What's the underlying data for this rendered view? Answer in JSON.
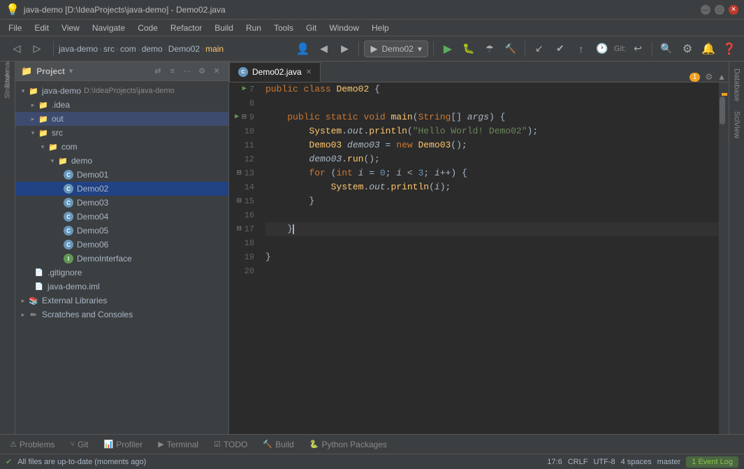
{
  "titleBar": {
    "title": "java-demo [D:\\IdeaProjects\\java-demo] - Demo02.java",
    "minimize": "—",
    "maximize": "□",
    "close": "✕"
  },
  "menuBar": {
    "items": [
      "File",
      "Edit",
      "View",
      "Navigate",
      "Code",
      "Refactor",
      "Build",
      "Run",
      "Tools",
      "Git",
      "Window",
      "Help"
    ]
  },
  "toolbar": {
    "runConfig": "Demo02",
    "gitLabel": "Git:"
  },
  "breadcrumb": {
    "items": [
      "java-demo",
      "src",
      "com",
      "demo",
      "Demo02",
      "main"
    ]
  },
  "projectPanel": {
    "title": "Project",
    "root": {
      "label": "java-demo",
      "path": "D:\\IdeaProjects\\java-demo",
      "children": [
        {
          "label": ".idea",
          "type": "folder",
          "expanded": false
        },
        {
          "label": "out",
          "type": "folder-out",
          "expanded": false,
          "selected": false,
          "highlighted": true
        },
        {
          "label": "src",
          "type": "folder",
          "expanded": true,
          "children": [
            {
              "label": "com",
              "type": "folder",
              "expanded": true,
              "children": [
                {
                  "label": "demo",
                  "type": "folder",
                  "expanded": true,
                  "children": [
                    {
                      "label": "Demo01",
                      "type": "java"
                    },
                    {
                      "label": "Demo02",
                      "type": "java",
                      "selected": true
                    },
                    {
                      "label": "Demo03",
                      "type": "java"
                    },
                    {
                      "label": "Demo04",
                      "type": "java"
                    },
                    {
                      "label": "Demo05",
                      "type": "java"
                    },
                    {
                      "label": "Demo06",
                      "type": "java"
                    },
                    {
                      "label": "DemoInterface",
                      "type": "java-interface"
                    }
                  ]
                }
              ]
            }
          ]
        },
        {
          "label": ".gitignore",
          "type": "file"
        },
        {
          "label": "java-demo.iml",
          "type": "file"
        }
      ]
    },
    "externalLibraries": "External Libraries",
    "scratches": "Scratches and Consoles"
  },
  "editorTab": {
    "filename": "Demo02.java",
    "warningCount": "1"
  },
  "codeLines": [
    {
      "num": 7,
      "content": "public class Demo02 {",
      "hasArrow": true
    },
    {
      "num": 8,
      "content": ""
    },
    {
      "num": 9,
      "content": "    public static void main(String[] args) {",
      "hasArrow": true,
      "hasBookmark": true
    },
    {
      "num": 10,
      "content": "        System.out.println(\"Hello World! Demo02\");"
    },
    {
      "num": 11,
      "content": "        Demo03 demo03 = new Demo03();"
    },
    {
      "num": 12,
      "content": "        demo03.run();"
    },
    {
      "num": 13,
      "content": "        for (int i = 0; i < 3; i++) {",
      "hasBookmark": true
    },
    {
      "num": 14,
      "content": "            System.out.println(i);"
    },
    {
      "num": 15,
      "content": "        }",
      "hasBookmark": true
    },
    {
      "num": 16,
      "content": ""
    },
    {
      "num": 17,
      "content": "    }",
      "hasBookmark": true,
      "isCursor": true
    },
    {
      "num": 18,
      "content": ""
    },
    {
      "num": 19,
      "content": "}"
    },
    {
      "num": 20,
      "content": ""
    }
  ],
  "bottomTabs": [
    {
      "label": "Problems",
      "icon": "⚠"
    },
    {
      "label": "Git",
      "icon": "⑂"
    },
    {
      "label": "Profiler",
      "icon": "📊"
    },
    {
      "label": "Terminal",
      "icon": ">"
    },
    {
      "label": "TODO",
      "icon": "☑"
    },
    {
      "label": "Build",
      "icon": "🔨"
    },
    {
      "label": "Python Packages",
      "icon": "🐍"
    }
  ],
  "statusBar": {
    "message": "All files are up-to-date (moments ago)",
    "position": "17:6",
    "lineEnding": "CRLF",
    "encoding": "UTF-8",
    "indent": "4 spaces",
    "vcs": "master",
    "eventLog": "1  Event Log"
  },
  "rightPanels": [
    "Database",
    "SciView"
  ],
  "icons": {
    "chevronDown": "▾",
    "chevronRight": "▸",
    "folder": "📁",
    "play": "▶",
    "stop": "■",
    "debug": "🐛",
    "settings": "⚙",
    "search": "🔍"
  }
}
